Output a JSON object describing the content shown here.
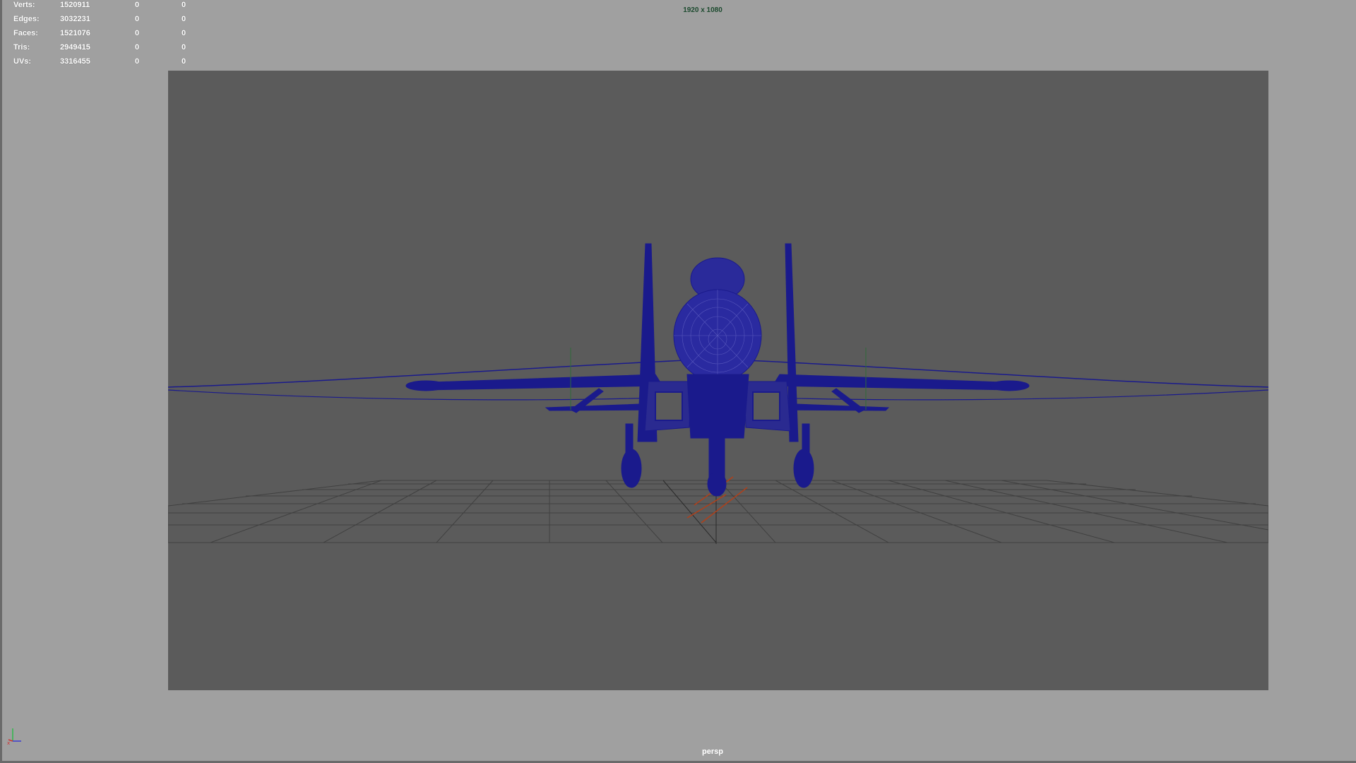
{
  "hud": {
    "rows": [
      {
        "label": "Verts:",
        "value": "1520911",
        "c1": "0",
        "c2": "0"
      },
      {
        "label": "Edges:",
        "value": "3032231",
        "c1": "0",
        "c2": "0"
      },
      {
        "label": "Faces:",
        "value": "1521076",
        "c1": "0",
        "c2": "0"
      },
      {
        "label": "Tris:",
        "value": "2949415",
        "c1": "0",
        "c2": "0"
      },
      {
        "label": "UVs:",
        "value": "3316455",
        "c1": "0",
        "c2": "0"
      }
    ]
  },
  "resolution_label": "1920 x 1080",
  "camera_name": "persp",
  "colors": {
    "background": "#a0a0a0",
    "resolution_gate": "#5b5b5b",
    "wireframe": "#1a1a8c",
    "grid": "#3a3a3a",
    "resolution_text": "#1c4a2e"
  },
  "icons": {
    "axis": "xyz-axis-icon"
  }
}
